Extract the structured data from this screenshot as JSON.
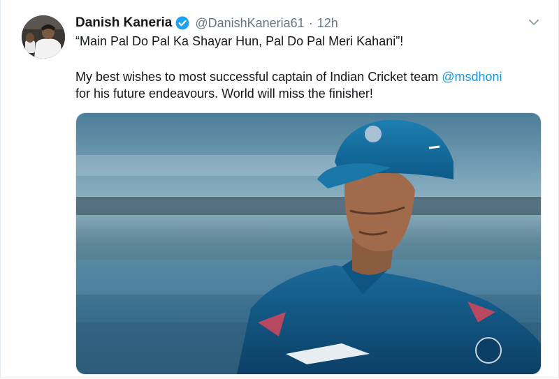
{
  "tweet": {
    "author_name": "Danish Kaneria",
    "handle": "@DanishKaneria61",
    "separator": "·",
    "time": "12h",
    "line1": "“Main Pal Do Pal Ka Shayar Hun, Pal Do Pal Meri Kahani”!",
    "line2_before": "My best wishes to most successful captain of Indian Cricket team ",
    "mention": "@msdhoni",
    "line3": "for his future endeavours. World will miss the finisher!"
  },
  "icons": {
    "verified": "verified-badge-icon",
    "more": "chevron-down-icon"
  },
  "colors": {
    "accent": "#1b95e0",
    "verified": "#1da1f2",
    "muted": "#657786"
  }
}
